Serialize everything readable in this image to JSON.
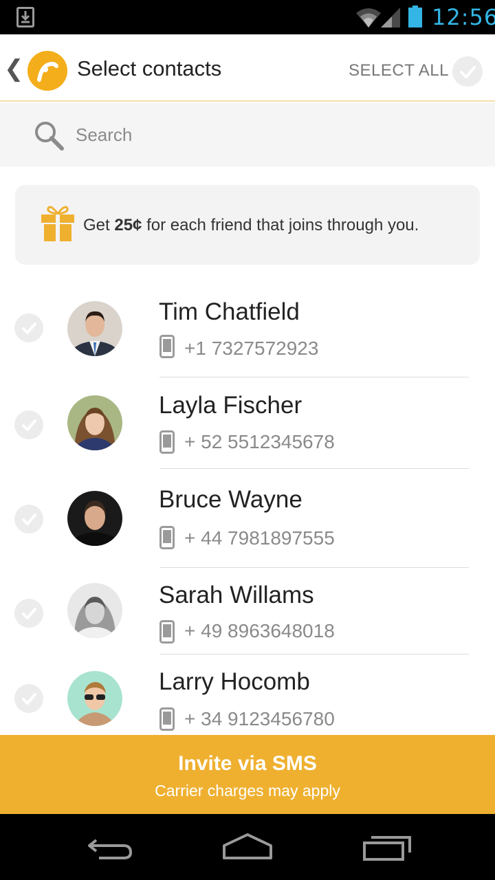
{
  "status_bar": {
    "time": "12:56",
    "icons": [
      "download-icon",
      "wifi-icon",
      "signal-icon",
      "battery-icon"
    ]
  },
  "header": {
    "title": "Select contacts",
    "select_all_label": "SELECT ALL",
    "icons": [
      "back-chevron-icon",
      "app-logo-icon",
      "checkmark-icon"
    ]
  },
  "search": {
    "placeholder": "Search",
    "value": ""
  },
  "promo": {
    "prefix": "Get ",
    "amount": "25¢",
    "suffix": " for each friend that joins through you.",
    "icon": "gift-icon"
  },
  "contacts": [
    {
      "name": "Tim Chatfield",
      "phone": "+1 7327572923",
      "selected": false
    },
    {
      "name": "Layla Fischer",
      "phone": "+ 52 5512345678",
      "selected": false
    },
    {
      "name": "Bruce Wayne",
      "phone": "+ 44 7981897555",
      "selected": false
    },
    {
      "name": "Sarah Willams",
      "phone": "+ 49 8963648018",
      "selected": false
    },
    {
      "name": "Larry Hocomb",
      "phone": "+ 34 9123456780",
      "selected": false
    }
  ],
  "invite": {
    "title": "Invite via SMS",
    "subtitle": "Carrier charges may apply"
  },
  "nav_bar": {
    "icons": [
      "back-icon",
      "home-icon",
      "recent-apps-icon"
    ]
  },
  "colors": {
    "accent": "#efb030",
    "logo": "#f4ae1b",
    "status_time": "#33b5e5"
  }
}
